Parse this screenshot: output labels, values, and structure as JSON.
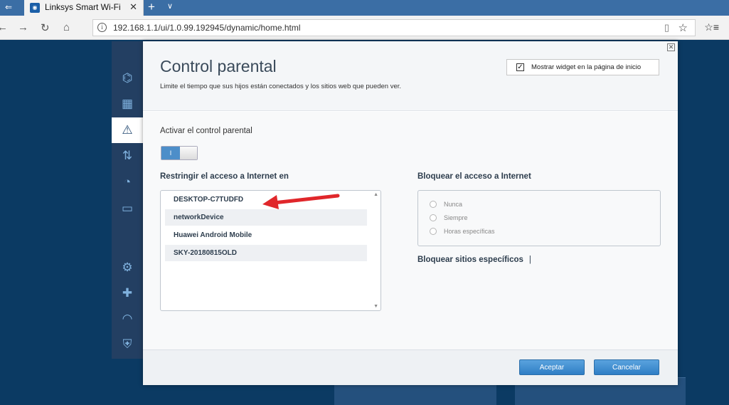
{
  "browser": {
    "tab_title": "Linksys Smart Wi-Fi",
    "address": "192.168.1.1/ui/1.0.99.192945/dynamic/home.html"
  },
  "modal": {
    "title": "Control parental",
    "subtitle": "Limite el tiempo que sus hijos están conectados y los sitios web que pueden ver.",
    "widget_label": "Mostrar widget en la página de inicio",
    "widget_checked": true,
    "enable_label": "Activar el control parental",
    "toggle_state": "I",
    "restrict_label": "Restringir el acceso a Internet en",
    "devices": [
      "DESKTOP-C7TUDFD",
      "networkDevice",
      "Huawei Android Mobile",
      "SKY-20180815OLD"
    ],
    "block_label": "Bloquear el acceso a Internet",
    "block_options": [
      "Nunca",
      "Siempre",
      "Horas específicas"
    ],
    "block_sites_label": "Bloquear sitios específicos",
    "block_sites_cursor": "|",
    "accept_label": "Aceptar",
    "cancel_label": "Cancelar"
  },
  "sidebar_icons": [
    "network-map-icon",
    "device-list-icon",
    "parental-controls-icon",
    "media-prioritization-icon",
    "speed-test-icon",
    "external-storage-icon",
    "connectivity-icon",
    "troubleshooting-icon",
    "wireless-icon",
    "security-icon"
  ],
  "colors": {
    "accent": "#3a87c9",
    "arrow": "#e0272b",
    "sidebar": "#233f62"
  }
}
